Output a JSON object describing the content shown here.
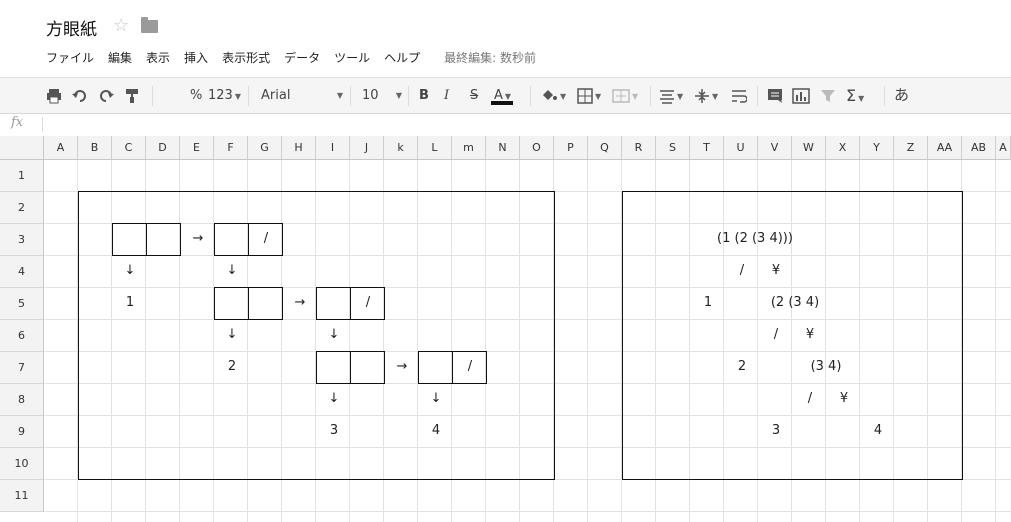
{
  "doc": {
    "title": "方眼紙",
    "star_icon": "☆"
  },
  "menu": {
    "items": [
      "ファイル",
      "編集",
      "表示",
      "挿入",
      "表示形式",
      "データ",
      "ツール",
      "ヘルプ"
    ],
    "last_edit": "最終編集: 数秒前"
  },
  "toolbar": {
    "percent": "%",
    "number_format": "123",
    "font": "Arial",
    "font_size": "10",
    "bold": "B",
    "italic": "I",
    "strike": "S",
    "text_color": "A",
    "sum": "Σ",
    "input_tools": "あ"
  },
  "formula_bar": {
    "label": "fx",
    "value": ""
  },
  "columns": [
    "A",
    "B",
    "C",
    "D",
    "E",
    "F",
    "G",
    "H",
    "I",
    "J",
    "k",
    "L",
    "m",
    "N",
    "O",
    "P",
    "Q",
    "R",
    "S",
    "T",
    "U",
    "V",
    "W",
    "X",
    "Y",
    "Z",
    "AA",
    "AB",
    "A"
  ],
  "rows": [
    "1",
    "2",
    "3",
    "4",
    "5",
    "6",
    "7",
    "8",
    "9",
    "10",
    "11"
  ],
  "left_diagram": {
    "arrow_right": "→",
    "arrow_down": "↓",
    "slash": "/",
    "leaf1": "1",
    "leaf2": "2",
    "leaf3": "3",
    "leaf4": "4"
  },
  "right_diagram": {
    "expr1": "(1 (2 (3 4)))",
    "expr2": "(2 (3 4)",
    "expr3": "(3 4)",
    "slash": "/",
    "yen": "¥",
    "leaf1": "1",
    "leaf2": "2",
    "leaf3": "3",
    "leaf4": "4"
  }
}
